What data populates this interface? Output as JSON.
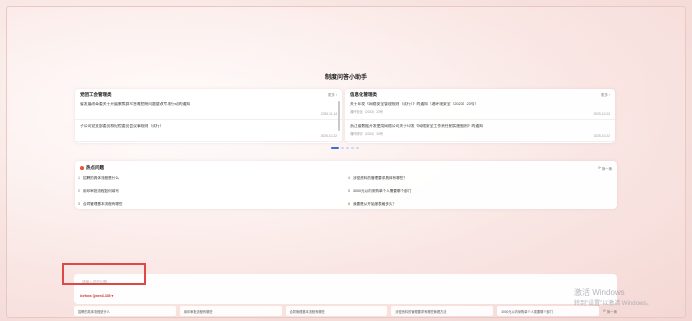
{
  "app": {
    "title": "制度问答小助手"
  },
  "left_card": {
    "title": "党团工会管理类",
    "more": "更多",
    "items": [
      {
        "title": "省发展改革委关于开展聚焦群众急难愁盼问题整改专项行动的通知",
        "sub": "",
        "date": "2025-11-14"
      },
      {
        "title": "子公司党支部委员和纪检委员会议事规则（试行）",
        "sub": "",
        "date": "2025-10-22"
      }
    ]
  },
  "right_card": {
    "title": "信息化管理类",
    "more": "更多",
    "items": [
      {
        "title": "关于印发《网络安全管理规则（试行）》的通知（湘环境安全〔2023〕23号）",
        "sub": "湘环安全〔2023〕23号",
        "date": "2025-10-03"
      },
      {
        "title": "浙江省数据开发使用网络公司关于印发《网络安全工作责任制实施细则》的通知",
        "sub": "湘环研字〔2024〕34号",
        "date": "2025-10-22"
      }
    ]
  },
  "carousel": {
    "count": 5,
    "active": 0
  },
  "hot": {
    "title": "热点问题",
    "swap": "换一换",
    "left": [
      {
        "num": "1",
        "text": "招聘的具体流程是什么"
      },
      {
        "num": "2",
        "text": "用印审批流程如何填写"
      },
      {
        "num": "3",
        "text": "合同管理基本流程有哪些"
      }
    ],
    "right": [
      {
        "num": "4",
        "text": "涉密资料的管理要求具体有哪些？"
      },
      {
        "num": "5",
        "text": "3000元以内采购单个人需要哪个部门"
      },
      {
        "num": "6",
        "text": "我要是从开始报表格多久？"
      }
    ]
  },
  "input": {
    "placeholder": "请输入您的问题",
    "model": "Icefoxs Qwen3-335 ▾"
  },
  "suggestions": [
    "招聘的具体流程是什么",
    "用印审批流程有哪些",
    "合同管理基本流程有哪些",
    "涉密资料的管理要求有哪些管理方法",
    "3000元以内采购单个人需要哪个部门"
  ],
  "suggest_swap": "换一换",
  "watermark": {
    "line1": "激活 Windows",
    "line2": "转到\"设置\"以激活 Windows。"
  }
}
